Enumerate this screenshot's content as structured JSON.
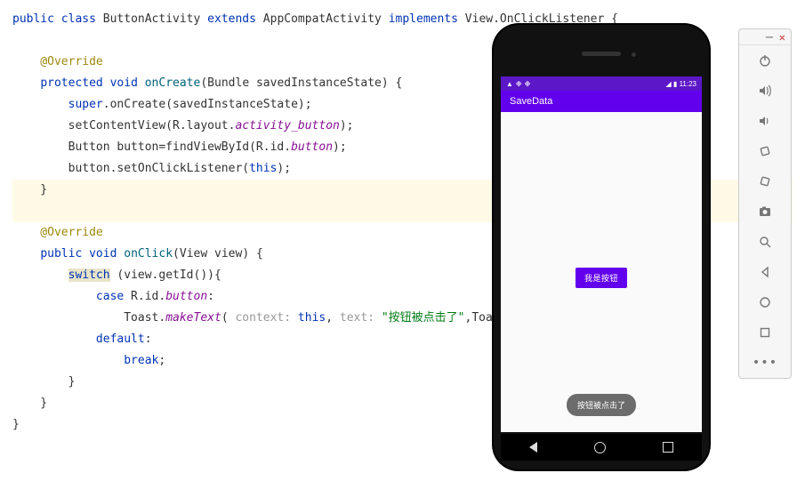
{
  "code": {
    "l1": [
      {
        "c": "kw",
        "t": "public"
      },
      {
        "c": "",
        "t": " "
      },
      {
        "c": "kw",
        "t": "class"
      },
      {
        "c": "",
        "t": " ButtonActivity "
      },
      {
        "c": "kw",
        "t": "extends"
      },
      {
        "c": "",
        "t": " AppCompatActivity "
      },
      {
        "c": "kw",
        "t": "implements"
      },
      {
        "c": "",
        "t": " View.OnClickListener {"
      }
    ],
    "l3": [
      {
        "c": "ann",
        "t": "    @Override"
      }
    ],
    "l4": [
      {
        "c": "",
        "t": "    "
      },
      {
        "c": "kw",
        "t": "protected"
      },
      {
        "c": "",
        "t": " "
      },
      {
        "c": "kw",
        "t": "void"
      },
      {
        "c": "",
        "t": " "
      },
      {
        "c": "mth",
        "t": "onCreate"
      },
      {
        "c": "",
        "t": "(Bundle savedInstanceState) {"
      }
    ],
    "l5": [
      {
        "c": "",
        "t": "        "
      },
      {
        "c": "kw",
        "t": "super"
      },
      {
        "c": "",
        "t": ".onCreate(savedInstanceState);"
      }
    ],
    "l6": [
      {
        "c": "",
        "t": "        setContentView(R.layout."
      },
      {
        "c": "fld",
        "t": "activity_button"
      },
      {
        "c": "",
        "t": ");"
      }
    ],
    "l7": [
      {
        "c": "",
        "t": "        Button button=findViewById(R.id."
      },
      {
        "c": "fld",
        "t": "button"
      },
      {
        "c": "",
        "t": ");"
      }
    ],
    "l8": [
      {
        "c": "",
        "t": "        button.setOnClickListener("
      },
      {
        "c": "kw",
        "t": "this"
      },
      {
        "c": "",
        "t": ");"
      }
    ],
    "l9": [
      {
        "c": "",
        "t": "    }"
      }
    ],
    "l11": [
      {
        "c": "ann",
        "t": "    @Override"
      }
    ],
    "l12": [
      {
        "c": "",
        "t": "    "
      },
      {
        "c": "kw",
        "t": "public"
      },
      {
        "c": "",
        "t": " "
      },
      {
        "c": "kw",
        "t": "void"
      },
      {
        "c": "",
        "t": " "
      },
      {
        "c": "mth",
        "t": "onClick"
      },
      {
        "c": "",
        "t": "(View view) {"
      }
    ],
    "l13": [
      {
        "c": "",
        "t": "        "
      },
      {
        "c": "kw hl-sw",
        "t": "switch"
      },
      {
        "c": "",
        "t": " (view.getId()){"
      }
    ],
    "l14": [
      {
        "c": "",
        "t": "            "
      },
      {
        "c": "kw",
        "t": "case"
      },
      {
        "c": "",
        "t": " R.id."
      },
      {
        "c": "fld",
        "t": "button"
      },
      {
        "c": "",
        "t": ":"
      }
    ],
    "l15": [
      {
        "c": "",
        "t": "                Toast."
      },
      {
        "c": "fld",
        "t": "makeText"
      },
      {
        "c": "",
        "t": "( "
      },
      {
        "c": "param-hint",
        "t": "context: "
      },
      {
        "c": "kw",
        "t": "this"
      },
      {
        "c": "",
        "t": ", "
      },
      {
        "c": "param-hint",
        "t": "text: "
      },
      {
        "c": "str",
        "t": "\"按钮被点击了\""
      },
      {
        "c": "",
        "t": ",Toas"
      }
    ],
    "l16": [
      {
        "c": "",
        "t": "            "
      },
      {
        "c": "kw",
        "t": "default"
      },
      {
        "c": "",
        "t": ":"
      }
    ],
    "l17": [
      {
        "c": "",
        "t": "                "
      },
      {
        "c": "kw",
        "t": "break"
      },
      {
        "c": "",
        "t": ";"
      }
    ],
    "l18": [
      {
        "c": "",
        "t": "        }"
      }
    ],
    "l19": [
      {
        "c": "",
        "t": "    }"
      }
    ],
    "l20": [
      {
        "c": "",
        "t": "}"
      }
    ]
  },
  "phone": {
    "status_time": "11:23",
    "app_title": "SaveData",
    "button_label": "我是按钮",
    "toast_text": "按钮被点击了"
  },
  "toolbar": {
    "icons": [
      "power",
      "volume-up",
      "volume-down",
      "rotate-left",
      "rotate-right",
      "camera",
      "search",
      "back-triangle",
      "circle",
      "square",
      "more"
    ]
  }
}
